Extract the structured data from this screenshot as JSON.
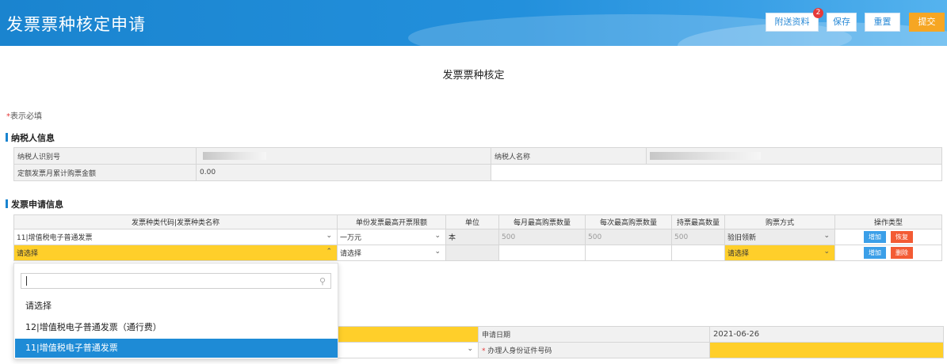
{
  "header": {
    "title": "发票票种核定申请",
    "buttons": {
      "attach": "附送资料",
      "save": "保存",
      "reset": "重置",
      "submit": "提交"
    },
    "attach_badge": "2"
  },
  "form_title": "发票票种核定",
  "required_note": {
    "star": "*",
    "text": "表示必填"
  },
  "taxpayer_section": {
    "title": "纳税人信息",
    "taxpayer_id_label": "纳税人识别号",
    "taxpayer_name_label": "纳税人名称",
    "monthly_amount_label": "定额发票月累计购票金额",
    "monthly_amount_value": "0.00"
  },
  "invoice_section": {
    "title": "发票申请信息",
    "headers": [
      "发票种类代码|发票种类名称",
      "单份发票最高开票限额",
      "单位",
      "每月最高购票数量",
      "每次最高购票数量",
      "持票最高数量",
      "购票方式",
      "操作类型"
    ],
    "rows": [
      {
        "type": "11|增值税电子普通发票",
        "limit": "一万元",
        "unit": "本",
        "monthly": "500",
        "per_time": "500",
        "hold": "500",
        "method": "验旧领新",
        "op1": "增加",
        "op2": "恢复"
      },
      {
        "type": "请选择",
        "limit": "请选择",
        "unit": "",
        "monthly": "",
        "per_time": "",
        "hold": "",
        "method": "请选择",
        "op1": "增加",
        "op2": "删除"
      }
    ]
  },
  "lower_table": {
    "apply_date_label": "申请日期",
    "apply_date_value": "2021-06-26",
    "handler_id_star": "*",
    "handler_id_label": "办理人身份证件号码"
  },
  "dropdown": {
    "search_placeholder": "",
    "options": [
      "请选择",
      "12|增值税电子普通发票（通行费）",
      "11|增值税电子普通发票"
    ],
    "selected_index": 2
  },
  "colors": {
    "header_blue": "#1a84cf",
    "required_yellow": "#ffcf2a",
    "submit_orange": "#f6a623",
    "add_blue": "#3b9fe8",
    "delete_red": "#f35b34"
  }
}
